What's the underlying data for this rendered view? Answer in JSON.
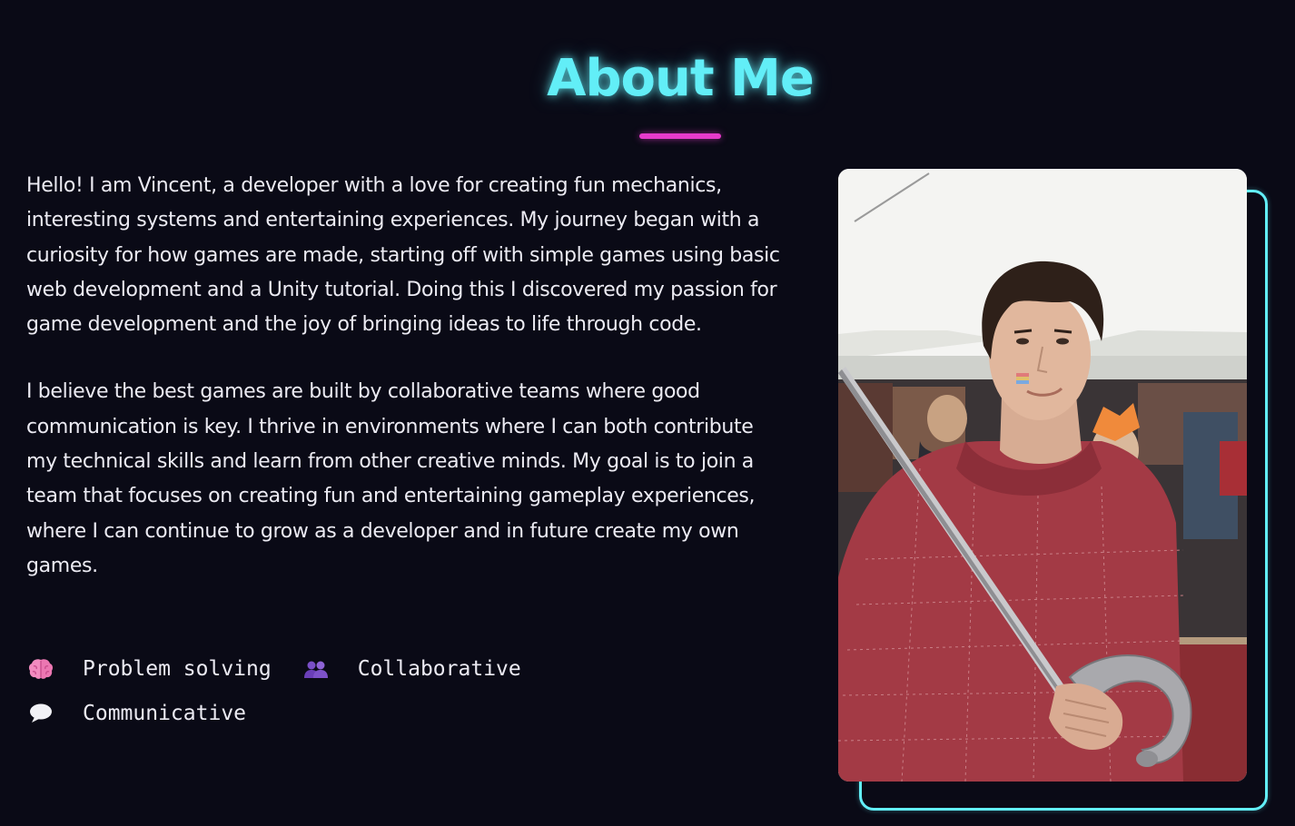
{
  "section": {
    "title": "About Me"
  },
  "bio": {
    "paragraphs": [
      "Hello! I am Vincent, a developer with a love for creating fun mechanics, interesting systems and entertaining experiences. My journey began with a curiosity for how games are made, starting off with simple games using basic web development and a Unity tutorial. Doing this I discovered my passion for game development and the joy of bringing ideas to life through code.",
      "I believe the best games are built by collaborative teams where good communication is key. I thrive in environments where I can both contribute my technical skills and learn from other creative minds. My goal is to join a team that focuses on creating fun and entertaining gameplay experiences, where I can continue to grow as a developer and in future create my own games."
    ]
  },
  "traits": [
    {
      "icon": "brain-icon",
      "label": "Problem solving"
    },
    {
      "icon": "people-icon",
      "label": "Collaborative"
    },
    {
      "icon": "speech-bubble-icon",
      "label": "Communicative"
    }
  ],
  "colors": {
    "background": "#0a0a16",
    "accent_cyan": "#62eef7",
    "accent_magenta": "#e63bcb",
    "text": "#ecebf3"
  },
  "photo": {
    "subject": "profile-photo"
  }
}
